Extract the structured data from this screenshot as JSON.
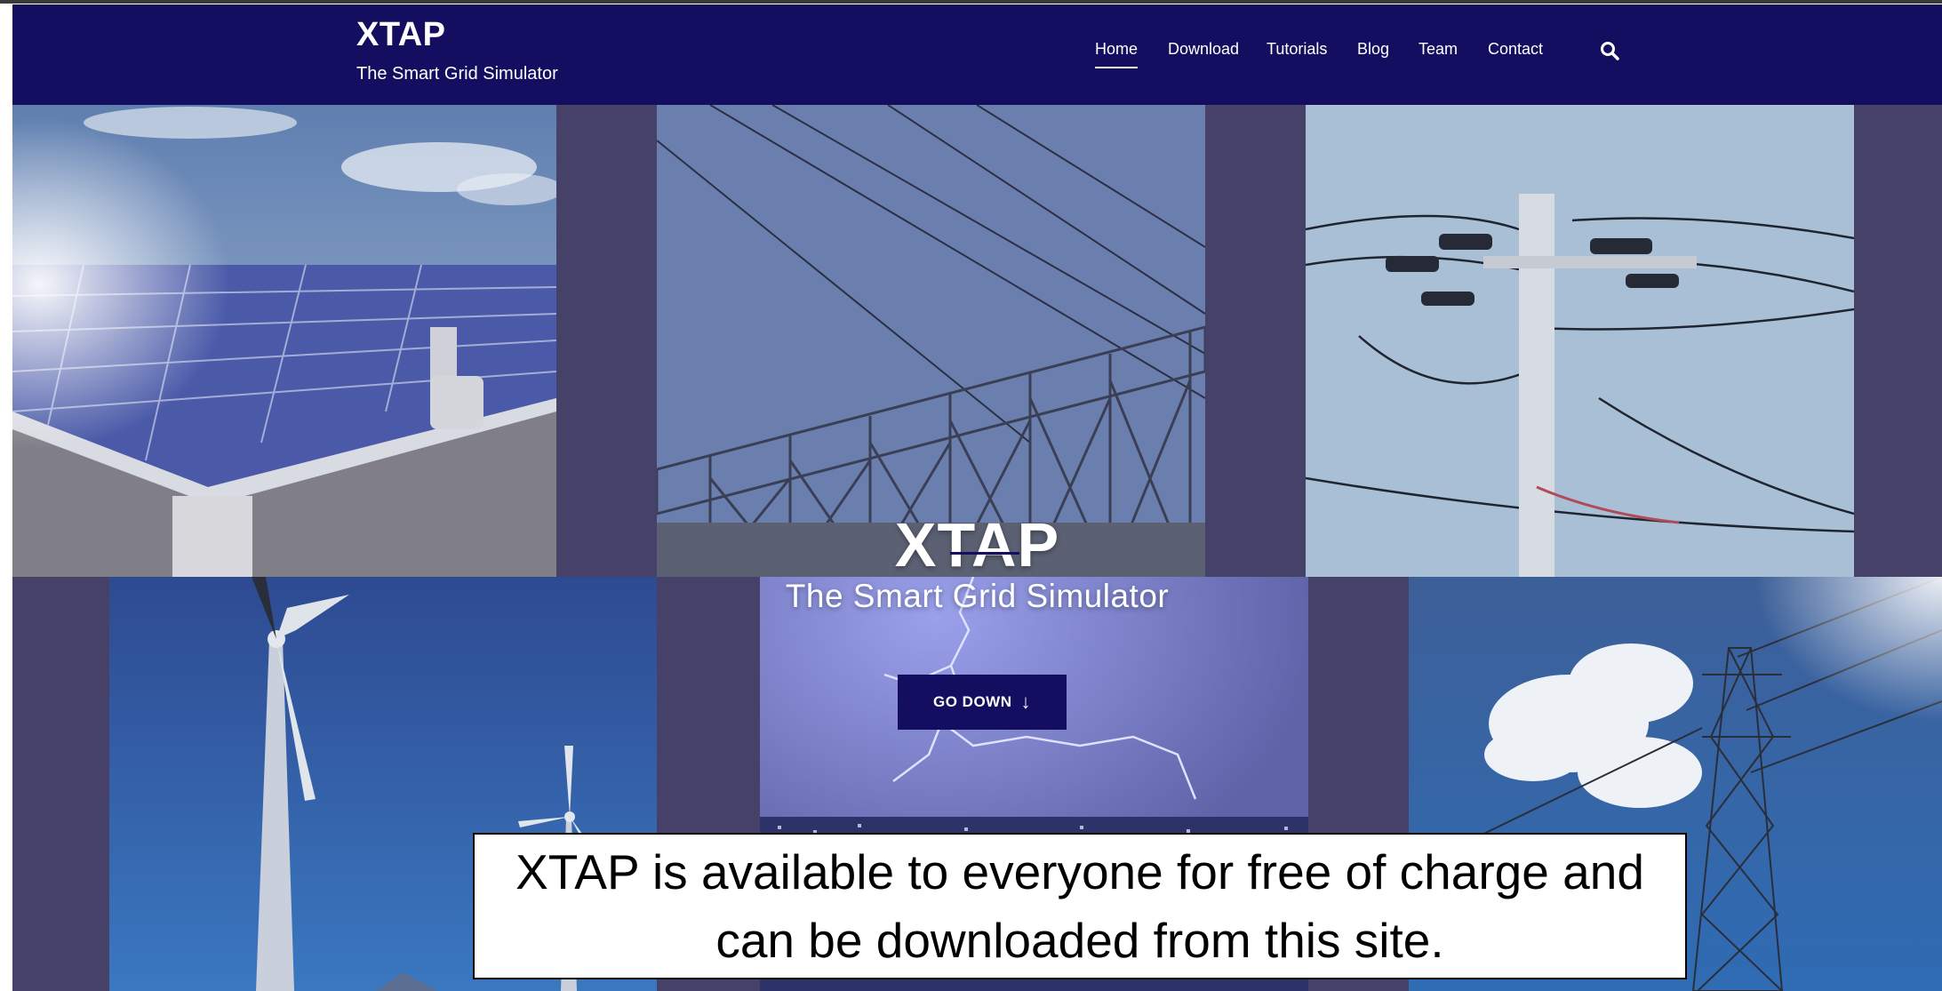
{
  "site": {
    "title": "XTAP",
    "tagline": "The Smart Grid Simulator"
  },
  "nav": {
    "items": [
      "Home",
      "Download",
      "Tutorials",
      "Blog",
      "Team",
      "Contact"
    ],
    "active": "Home",
    "search_icon": "search-icon"
  },
  "hero": {
    "title": "XTAP",
    "subtitle": "The Smart Grid Simulator",
    "button_label": "GO DOWN",
    "button_icon": "↓",
    "tiles": [
      "solar-panels",
      "substation",
      "power-pole",
      "wind-turbines",
      "lightning-city",
      "transmission-tower"
    ]
  },
  "caption": {
    "text": "XTAP is available to everyone for free of charge and can be downloaded from this site."
  },
  "colors": {
    "nav_bg": "#130e5f",
    "hero_gap": "#454168",
    "button_bg": "#130e5f"
  }
}
